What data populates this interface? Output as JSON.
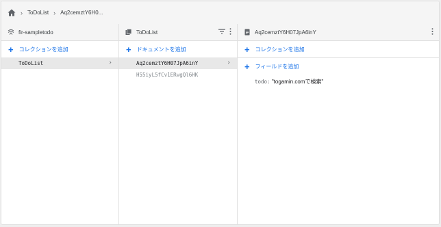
{
  "breadcrumb": {
    "items": [
      "ToDoList",
      "Aq2cemztY6H0..."
    ]
  },
  "collections_panel": {
    "title": "fir-sampletodo",
    "add_label": "コレクションを追加",
    "items": [
      {
        "label": "ToDoList",
        "selected": true
      }
    ]
  },
  "documents_panel": {
    "title": "ToDoList",
    "add_label": "ドキュメントを追加",
    "items": [
      {
        "label": "Aq2cemztY6H07JpA6inY",
        "selected": true
      },
      {
        "label": "H55iyL5fCv1ERwgQl6HK",
        "selected": false
      }
    ]
  },
  "document_panel": {
    "title": "Aq2cemztY6H07JpA6inY",
    "add_collection_label": "コレクションを追加",
    "add_field_label": "フィールドを追加",
    "fields": [
      {
        "key": "todo:",
        "value": "\"togamin.comで検索\""
      }
    ]
  },
  "colors": {
    "accent": "#1a73e8",
    "selected_row": "#e8e8e8",
    "header_bg": "#f5f5f5"
  }
}
